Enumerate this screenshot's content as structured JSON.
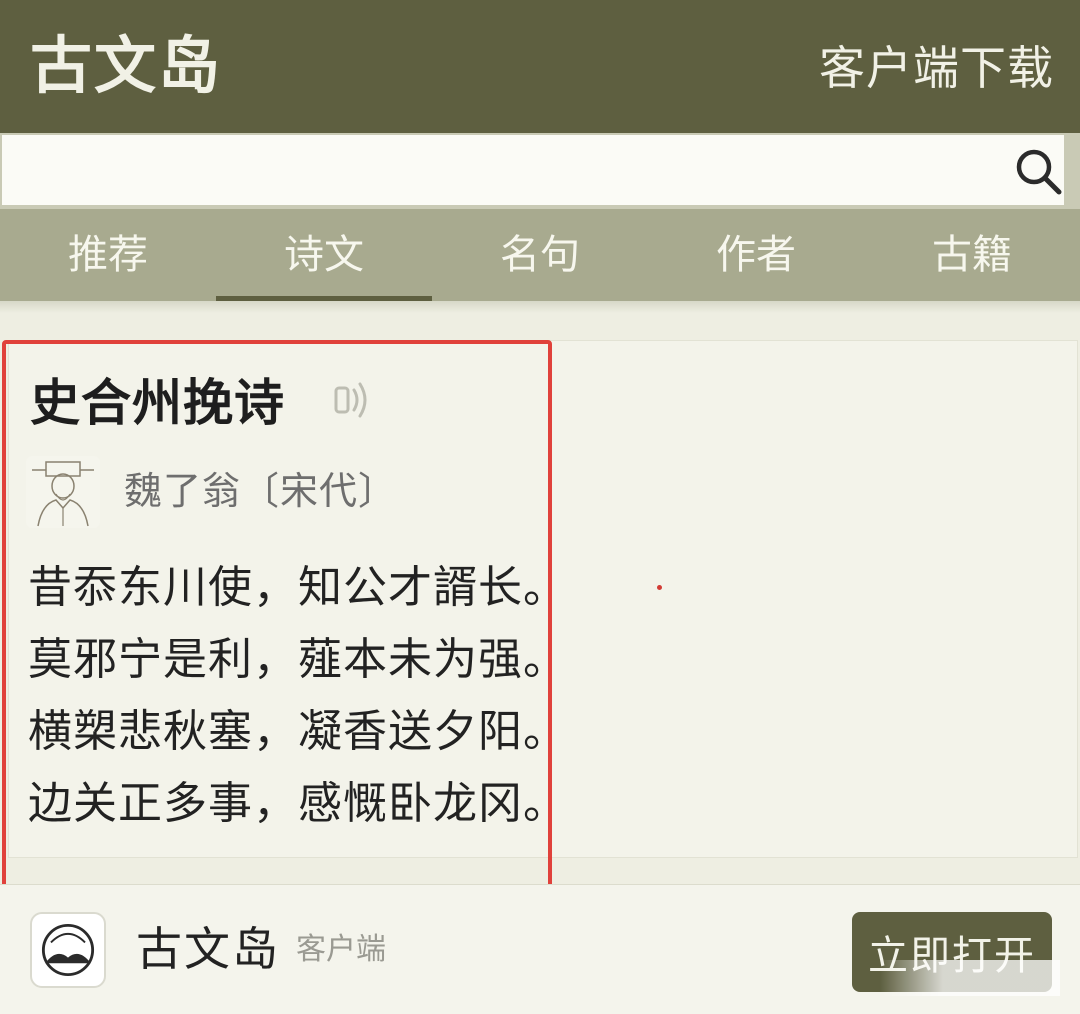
{
  "header": {
    "brand": "古文岛",
    "download_label": "客户端下载"
  },
  "search": {
    "value": "",
    "icon": "search-icon"
  },
  "tabs": [
    {
      "label": "推荐",
      "active": false
    },
    {
      "label": "诗文",
      "active": true
    },
    {
      "label": "名句",
      "active": false
    },
    {
      "label": "作者",
      "active": false
    },
    {
      "label": "古籍",
      "active": false
    }
  ],
  "poem": {
    "title": "史合州挽诗",
    "author": "魏了翁〔宋代〕",
    "lines": [
      "昔忝东川使，知公才諝长。",
      "莫邪宁是利，薤本未为强。",
      "横槊悲秋塞，凝香送夕阳。",
      "边关正多事，感慨卧龙冈。"
    ],
    "audio_icon": "speaker-icon"
  },
  "app_banner": {
    "name": "古文岛",
    "subtitle": "客户端",
    "open_label": "立即打开"
  },
  "colors": {
    "header_bg": "#5e5f40",
    "tabs_bg": "#a8aa8f",
    "highlight": "#e0413b",
    "page_bg": "#eeeee2"
  }
}
